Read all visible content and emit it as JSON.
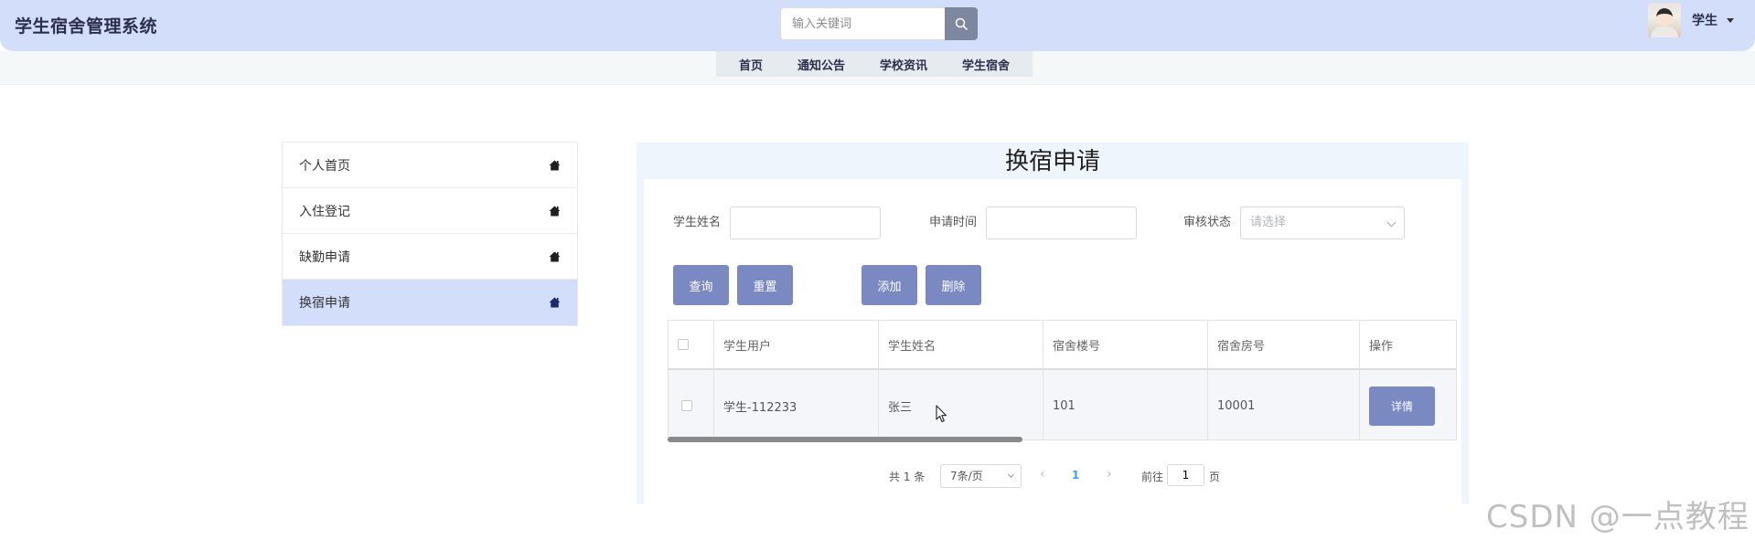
{
  "header": {
    "title": "学生宿舍管理系统",
    "search_placeholder": "输入关键词",
    "user_name": "学生"
  },
  "nav": {
    "items": [
      "首页",
      "通知公告",
      "学校资讯",
      "学生宿舍"
    ]
  },
  "sidebar": {
    "items": [
      {
        "label": "个人首页"
      },
      {
        "label": "入住登记"
      },
      {
        "label": "缺勤申请"
      },
      {
        "label": "换宿申请",
        "active": true
      }
    ]
  },
  "main": {
    "title": "换宿申请",
    "filters": {
      "name_label": "学生姓名",
      "time_label": "申请时间",
      "status_label": "审核状态",
      "status_placeholder": "请选择"
    },
    "buttons": {
      "query": "查询",
      "reset": "重置",
      "add": "添加",
      "delete": "删除"
    },
    "table": {
      "headers": [
        "学生用户",
        "学生姓名",
        "宿舍楼号",
        "宿舍房号",
        "操作"
      ],
      "rows": [
        {
          "user": "学生-112233",
          "name": "张三",
          "building": "101",
          "room": "10001",
          "action": "详情"
        }
      ]
    },
    "pagination": {
      "total_text": "共 1 条",
      "page_size": "7条/页",
      "current_page": "1",
      "goto_label": "前往",
      "goto_value": "1",
      "page_suffix": "页"
    }
  },
  "watermark": "CSDN @一点教程",
  "colors": {
    "header_bg": "#d3defa",
    "accent_button": "#7a89c2",
    "active_sidebar": "#d3defa",
    "page_link": "#409eff"
  }
}
